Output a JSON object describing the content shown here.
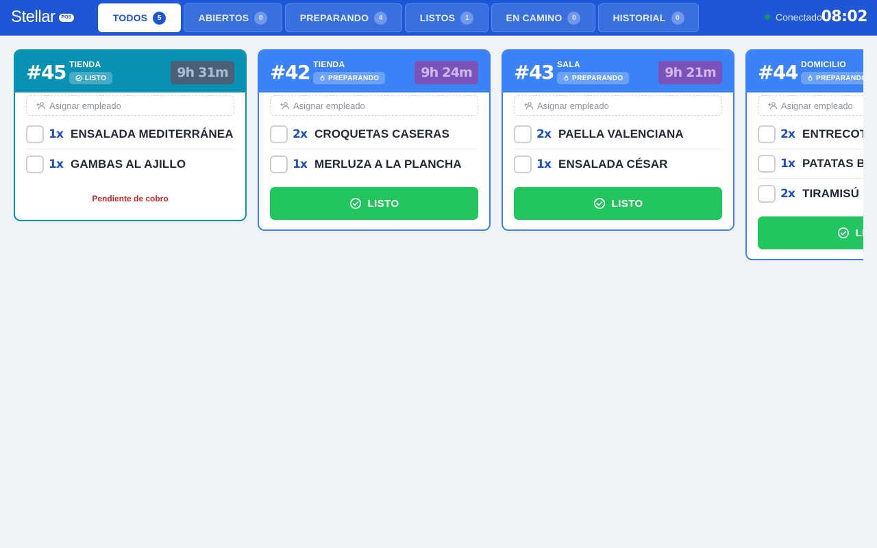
{
  "brand": {
    "name": "Stellar",
    "badge": "POS"
  },
  "tabs": [
    {
      "label": "TODOS",
      "count": "5"
    },
    {
      "label": "ABIERTOS",
      "count": "0"
    },
    {
      "label": "PREPARANDO",
      "count": "4"
    },
    {
      "label": "LISTOS",
      "count": "1"
    },
    {
      "label": "EN CAMINO",
      "count": "0"
    },
    {
      "label": "HISTORIAL",
      "count": "0"
    }
  ],
  "connection": {
    "label": "Conectado",
    "color": "#1a8f6b"
  },
  "clock": "08:02",
  "colors": {
    "header_bar": "#1e56d6",
    "preparing": "#3b82f6",
    "ready": "#0891b2",
    "done_button": "#22c55e",
    "pending_text": "#c62828"
  },
  "orders": [
    {
      "number": "#45",
      "origin": "TIENDA",
      "state": "LISTO",
      "state_icon": "check-circle-icon",
      "timer": "9h 31m",
      "assign_placeholder": "Asignar empleado",
      "items": [
        {
          "qty": "1x",
          "name": "ENSALADA MEDITERRÁNEA"
        },
        {
          "qty": "1x",
          "name": "GAMBAS AL AJILLO"
        }
      ],
      "footer_note": "Pendiente de cobro"
    },
    {
      "number": "#42",
      "origin": "TIENDA",
      "state": "PREPARANDO",
      "state_icon": "flame-icon",
      "timer": "9h 24m",
      "assign_placeholder": "Asignar empleado",
      "items": [
        {
          "qty": "2x",
          "name": "CROQUETAS CASERAS"
        },
        {
          "qty": "1x",
          "name": "MERLUZA A LA PLANCHA"
        }
      ],
      "action_label": "LISTO"
    },
    {
      "number": "#43",
      "origin": "SALA",
      "state": "PREPARANDO",
      "state_icon": "flame-icon",
      "timer": "9h 21m",
      "assign_placeholder": "Asignar empleado",
      "items": [
        {
          "qty": "2x",
          "name": "PAELLA VALENCIANA"
        },
        {
          "qty": "1x",
          "name": "ENSALADA CÉSAR"
        }
      ],
      "action_label": "LISTO"
    },
    {
      "number": "#44",
      "origin": "DOMICILIO",
      "state": "PREPARANDO",
      "state_icon": "flame-icon",
      "timer": "",
      "assign_placeholder": "Asignar empleado",
      "items": [
        {
          "qty": "2x",
          "name": "ENTRECOT"
        },
        {
          "qty": "1x",
          "name": "PATATAS B"
        },
        {
          "qty": "2x",
          "name": "TIRAMISÚ"
        }
      ],
      "action_label": "LISTO"
    }
  ]
}
